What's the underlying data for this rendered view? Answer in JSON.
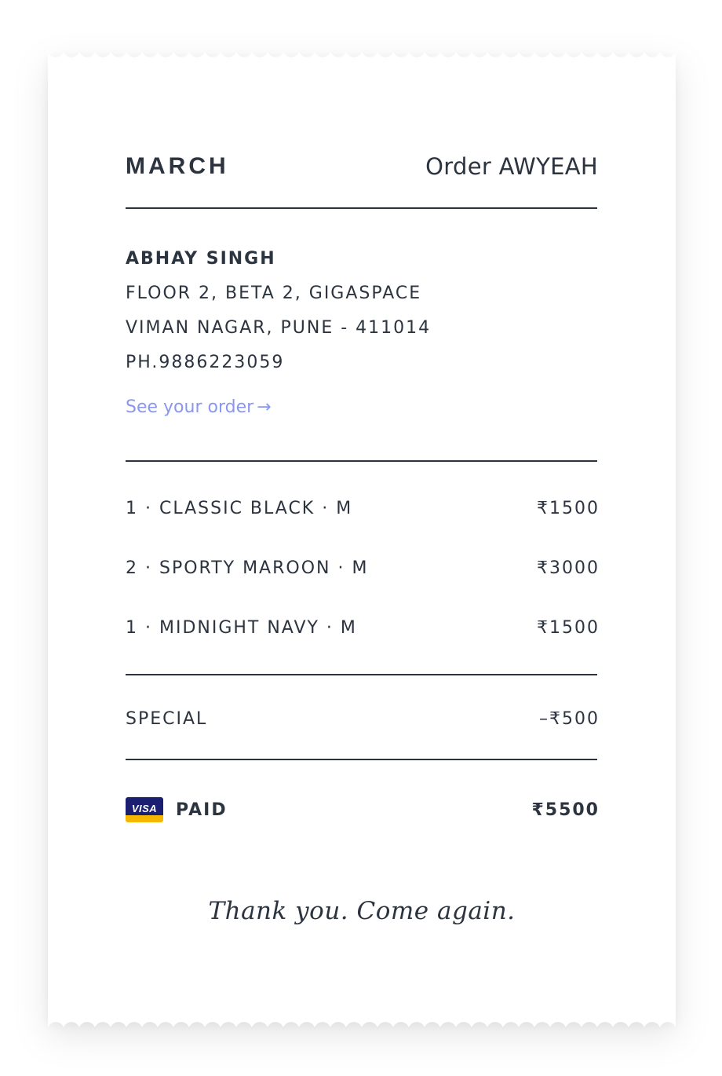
{
  "receipt": {
    "brand": "MARCH",
    "order_label": "Order AWYEAH",
    "customer": {
      "name": "ABHAY SINGH",
      "address_line1": "FLOOR 2, BETA 2, GIGASPACE",
      "address_line2": "VIMAN NAGAR, PUNE - 411014",
      "phone": "PH.9886223059"
    },
    "see_order_link": "See your order",
    "see_order_arrow": "→",
    "items": [
      {
        "description": "1 · CLASSIC BLACK · M",
        "price": "₹1500"
      },
      {
        "description": "2 · SPORTY MAROON · M",
        "price": "₹3000"
      },
      {
        "description": "1 · MIDNIGHT NAVY · M",
        "price": "₹1500"
      }
    ],
    "discount": {
      "label": "SPECIAL",
      "amount": "–₹500"
    },
    "payment": {
      "card_icon": "visa-card-icon",
      "card_text": "VISA",
      "status": "PAID",
      "total": "₹5500"
    },
    "footer_message": "Thank you. Come again."
  },
  "colors": {
    "text": "#2c3440",
    "link": "#8a97f0",
    "visa_blue": "#1a1f71",
    "visa_gold": "#f7b600",
    "paper": "#ffffff"
  }
}
